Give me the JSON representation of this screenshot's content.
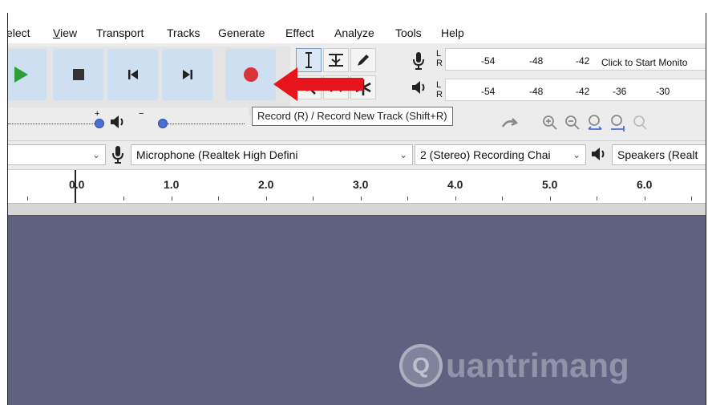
{
  "menu": {
    "items": [
      "elect",
      "View",
      "Transport",
      "Tracks",
      "Generate",
      "Effect",
      "Analyze",
      "Tools",
      "Help"
    ],
    "underlines": [
      null,
      "V",
      "s",
      "T",
      "G",
      "c",
      "A",
      "o",
      "H"
    ]
  },
  "transport": {
    "buttons": [
      "play-icon",
      "stop-icon",
      "skip-to-start-icon",
      "skip-to-end-icon",
      "record-icon"
    ],
    "record_color": "#d8343a",
    "play_color": "#2e9e3a"
  },
  "meters": {
    "lr_top": "L",
    "lr_bottom": "R",
    "record_ticks": [
      "-54",
      "-48",
      "-42"
    ],
    "record_hint": "Click to Start Monito",
    "play_ticks": [
      "-54",
      "-48",
      "-42",
      "-36",
      "-30"
    ]
  },
  "tooltip": {
    "text": "Record (R) / Record New Track (Shift+R)"
  },
  "mixer": {
    "record_sign": "+",
    "play_sign": "−",
    "record_level": 1.0,
    "play_level": 0.0
  },
  "device": {
    "host_value": "",
    "input_device": "Microphone (Realtek High Defini",
    "channels": "2 (Stereo) Recording Chai",
    "output_device": "Speakers (Realt"
  },
  "ruler": {
    "labels": [
      "0.0",
      "1.0",
      "2.0",
      "3.0",
      "4.0",
      "5.0",
      "6.0"
    ]
  },
  "watermark": {
    "badge": "Q",
    "text": "uantrimang"
  },
  "colors": {
    "track_bg": "#5e6180",
    "button_bg": "#cfdff2",
    "arrow": "#e8141c"
  }
}
